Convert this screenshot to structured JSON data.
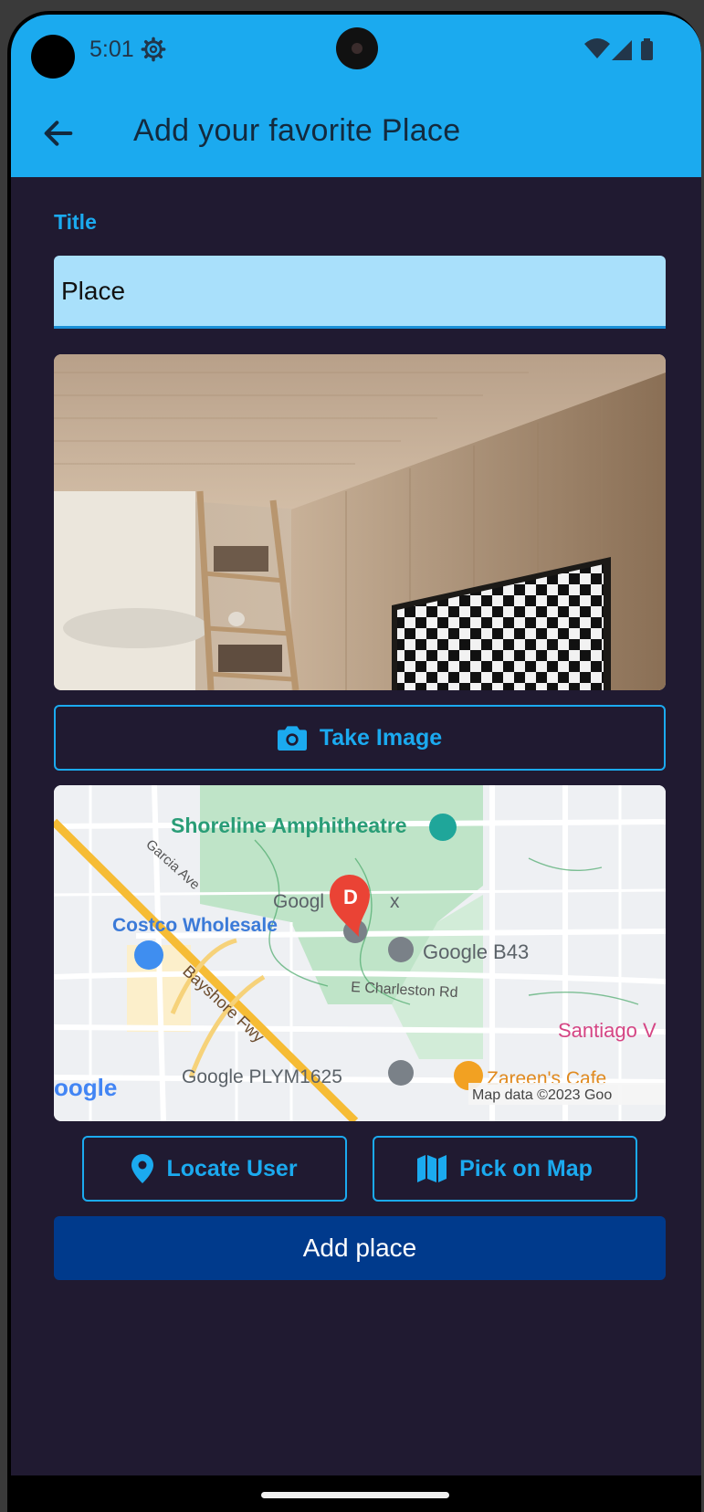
{
  "status_bar": {
    "time": "5:01"
  },
  "app_bar": {
    "title": "Add your favorite Place"
  },
  "form": {
    "title_label": "Title",
    "title_value": "Place"
  },
  "buttons": {
    "take_image": "Take Image",
    "locate_user": "Locate User",
    "pick_on_map": "Pick on Map",
    "add_place": "Add place"
  },
  "map": {
    "labels": {
      "shoreline": "Shoreline Amphitheatre",
      "garcia": "Garcia Ave",
      "costco": "Costco Wholesale",
      "googleplex_a": "Googl",
      "googleplex_b": "x",
      "google_b43": "Google B43",
      "charleston": "E Charleston Rd",
      "bayshore": "Bayshore Fwy",
      "santiago": "Santiago V",
      "plym": "Google PLYM1625",
      "zareen": "Zareen's Cafe",
      "google_logo": "oogle",
      "attribution": "Map data ©2023 Goo"
    },
    "marker_letter": "D"
  },
  "colors": {
    "app_bar": "#1baaef",
    "background": "#201a31",
    "accent": "#1baaef",
    "primary_button": "#003a8c",
    "input_fill": "#a9e0fb"
  },
  "icons": {
    "back": "arrow-left-icon",
    "camera": "camera-icon",
    "location": "location-pin-icon",
    "map": "map-icon",
    "settings": "gear-icon"
  }
}
